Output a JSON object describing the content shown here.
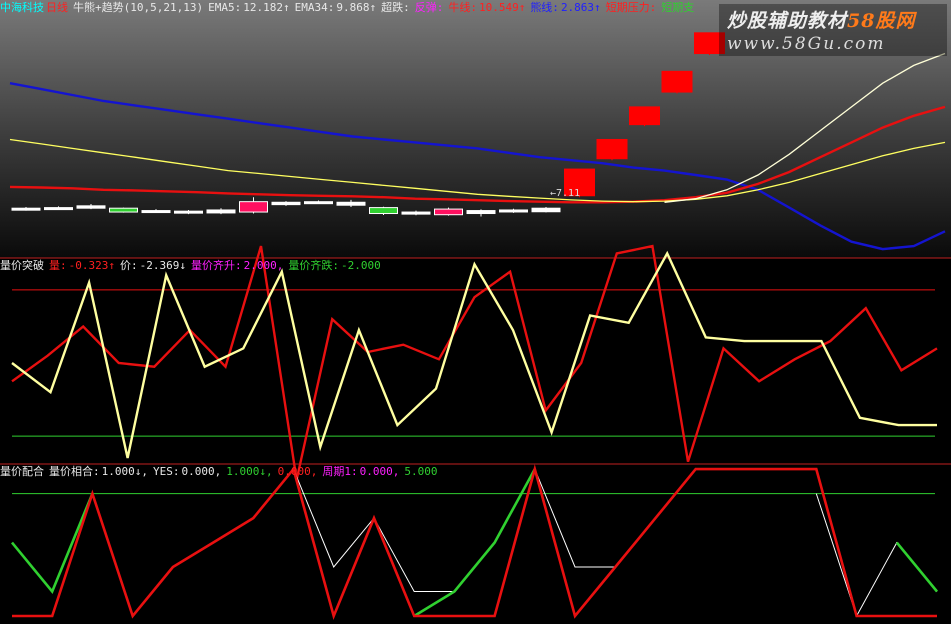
{
  "panel1": {
    "stock_name": "中海科技",
    "period": "日线",
    "indicator": "牛熊+趋势(10,5,21,13)",
    "ema5_label": "EMA5:",
    "ema5_value": "12.182↑",
    "ema34_label": "EMA34:",
    "ema34_value": "9.868↑",
    "overfall_label": "超跌:",
    "rebound_label": "反弹:",
    "bull_label": "牛线:",
    "bull_value": "10.549↑",
    "bear_label": "熊线:",
    "bear_value": "2.863↑",
    "short_pressure_label": "短期压力:",
    "short_support_label": "短期支",
    "low_annotation": "←7.11"
  },
  "panel2": {
    "title": "量价突破",
    "vol_label": "量:",
    "vol_value": "-0.323↑",
    "price_label": "价:",
    "price_value": "-2.369↓",
    "up_label": "量价齐升:",
    "up_value": "2.000,",
    "down_label": "量价齐跌:",
    "down_value": "-2.000"
  },
  "panel3": {
    "title": "量价配合",
    "match_label": "量价相合:",
    "match_value": "1.000↓,",
    "yes_label": "YES:",
    "yes_value": "0.000,",
    "green_value": "1.000↓,",
    "red_value": "0.000,",
    "period_label": "周期1:",
    "period_value": "0.000,",
    "last_value": "5.000"
  },
  "watermark": {
    "line1_a": "炒股辅助教材",
    "line1_b": "58股网",
    "line2": "www.58Gu.com"
  },
  "colors": {
    "red": "#e81010",
    "yellow": "#ffffa0",
    "green": "#30d030",
    "blue": "#1414d0",
    "magenta": "#ff20ff",
    "white": "#ffffff",
    "cyan": "#00ffff"
  },
  "chart_data": [
    {
      "type": "candlestick",
      "title": "牛熊+趋势(10,5,21,13)",
      "candles": [
        {
          "o": 8.55,
          "c": 8.58,
          "h": 8.62,
          "l": 8.5
        },
        {
          "o": 8.6,
          "c": 8.55,
          "h": 8.64,
          "l": 8.52
        },
        {
          "o": 8.58,
          "c": 8.66,
          "h": 8.72,
          "l": 8.55
        },
        {
          "o": 8.58,
          "c": 8.45,
          "h": 8.6,
          "l": 8.43
        },
        {
          "o": 8.45,
          "c": 8.5,
          "h": 8.55,
          "l": 8.42
        },
        {
          "o": 8.48,
          "c": 8.45,
          "h": 8.52,
          "l": 8.38
        },
        {
          "o": 8.42,
          "c": 8.52,
          "h": 8.58,
          "l": 8.38
        },
        {
          "o": 8.45,
          "c": 8.8,
          "h": 8.95,
          "l": 8.4
        },
        {
          "o": 8.7,
          "c": 8.78,
          "h": 8.82,
          "l": 8.66
        },
        {
          "o": 8.75,
          "c": 8.8,
          "h": 8.84,
          "l": 8.72
        },
        {
          "o": 8.78,
          "c": 8.68,
          "h": 8.86,
          "l": 8.62
        },
        {
          "o": 8.6,
          "c": 8.4,
          "h": 8.63,
          "l": 8.35
        },
        {
          "o": 8.45,
          "c": 8.38,
          "h": 8.5,
          "l": 8.34
        },
        {
          "o": 8.36,
          "c": 8.55,
          "h": 8.6,
          "l": 8.33
        },
        {
          "o": 8.5,
          "c": 8.4,
          "h": 8.54,
          "l": 8.3
        },
        {
          "o": 8.48,
          "c": 8.52,
          "h": 8.56,
          "l": 8.42
        },
        {
          "o": 8.46,
          "c": 8.58,
          "h": 8.62,
          "l": 8.44
        },
        {
          "o": 9.0,
          "c": 9.9,
          "h": 9.9,
          "l": 8.95
        },
        {
          "o": 10.25,
          "c": 10.9,
          "h": 10.9,
          "l": 10.2
        },
        {
          "o": 11.4,
          "c": 12.0,
          "h": 12.0,
          "l": 11.35
        },
        {
          "o": 12.5,
          "c": 13.2,
          "h": 13.2,
          "l": 12.45
        },
        {
          "o": 13.8,
          "c": 14.5,
          "h": 14.5,
          "l": 13.75
        }
      ],
      "series": [
        {
          "name": "EMA34",
          "color": "#1414d0",
          "values": [
            12.8,
            12.6,
            12.4,
            12.2,
            12.05,
            11.9,
            11.75,
            11.6,
            11.45,
            11.3,
            11.15,
            11.0,
            10.9,
            10.8,
            10.7,
            10.6,
            10.45,
            10.3,
            10.2,
            10.1,
            9.95,
            9.85,
            9.7,
            9.55,
            9.2,
            8.6,
            8.0,
            7.45,
            7.2,
            7.3,
            7.8
          ]
        },
        {
          "name": "EMA5",
          "color": "#e81010",
          "values": [
            9.3,
            9.28,
            9.25,
            9.2,
            9.18,
            9.15,
            9.12,
            9.08,
            9.05,
            9.02,
            9.0,
            8.98,
            8.95,
            8.9,
            8.88,
            8.85,
            8.82,
            8.8,
            8.78,
            8.78,
            8.8,
            8.85,
            8.95,
            9.1,
            9.4,
            9.8,
            10.3,
            10.8,
            11.3,
            11.7,
            12.0
          ]
        },
        {
          "name": "bull",
          "color": "#ffff60",
          "values": [
            10.9,
            10.75,
            10.6,
            10.45,
            10.3,
            10.15,
            10.0,
            9.85,
            9.75,
            9.65,
            9.55,
            9.45,
            9.35,
            9.25,
            9.15,
            9.05,
            8.98,
            8.92,
            8.86,
            8.82,
            8.8,
            8.82,
            8.88,
            9.0,
            9.2,
            9.45,
            9.75,
            10.05,
            10.35,
            10.6,
            10.8
          ]
        },
        {
          "name": "white",
          "color": "#ffffd8",
          "values": [
            null,
            null,
            null,
            null,
            null,
            null,
            null,
            null,
            null,
            null,
            null,
            null,
            null,
            null,
            null,
            null,
            null,
            null,
            null,
            null,
            null,
            8.78,
            8.9,
            9.2,
            9.7,
            10.4,
            11.2,
            12.0,
            12.8,
            13.4,
            13.8
          ]
        }
      ]
    },
    {
      "type": "line",
      "title": "量价突破",
      "ylim": [
        -2.6,
        2.6
      ],
      "hlines": [
        {
          "y": 2.0,
          "color": "#e81010"
        },
        {
          "y": -2.0,
          "color": "#30d030"
        }
      ],
      "series": [
        {
          "name": "量",
          "color": "#e81010",
          "values": [
            -0.5,
            0.2,
            1.0,
            0.0,
            -0.1,
            0.9,
            -0.1,
            3.2,
            -3.2,
            1.2,
            0.3,
            0.5,
            0.1,
            1.8,
            2.5,
            -1.3,
            0.0,
            3.0,
            3.2,
            -2.7,
            0.4,
            -0.5,
            0.1,
            0.6,
            1.5,
            -0.2,
            0.4
          ]
        },
        {
          "name": "价",
          "color": "#ffffa0",
          "values": [
            0.0,
            -0.8,
            2.2,
            -2.6,
            2.4,
            -0.1,
            0.4,
            2.5,
            -2.3,
            0.9,
            -1.7,
            -0.7,
            2.7,
            0.9,
            -1.9,
            1.3,
            1.1,
            3.0,
            0.7,
            0.6,
            0.6,
            0.6,
            -1.5,
            -1.7,
            -1.7
          ]
        }
      ]
    },
    {
      "type": "line",
      "title": "量价配合",
      "ylim": [
        0,
        5.8
      ],
      "hlines": [
        {
          "y": 5.0,
          "color": "#30d030"
        }
      ],
      "series": [
        {
          "name": "量价相合",
          "color": "#e81010",
          "values": [
            0,
            0,
            5,
            0,
            2,
            3,
            4,
            6,
            0,
            4,
            0,
            0,
            0,
            6,
            0,
            2,
            4,
            6,
            6,
            6,
            6,
            0,
            0,
            0
          ]
        },
        {
          "name": "YES",
          "color": "#30d030",
          "values": [
            3,
            1,
            5,
            null,
            null,
            null,
            null,
            null,
            null,
            null,
            0,
            1,
            3,
            6,
            null,
            null,
            null,
            null,
            null,
            null,
            null,
            null,
            3,
            1
          ]
        },
        {
          "name": "周期1",
          "color": "#ffffff",
          "values": [
            null,
            null,
            null,
            null,
            null,
            null,
            null,
            6,
            2,
            4,
            1,
            1,
            3,
            6,
            2,
            2,
            null,
            null,
            null,
            null,
            5,
            0,
            3,
            1
          ]
        }
      ]
    }
  ]
}
